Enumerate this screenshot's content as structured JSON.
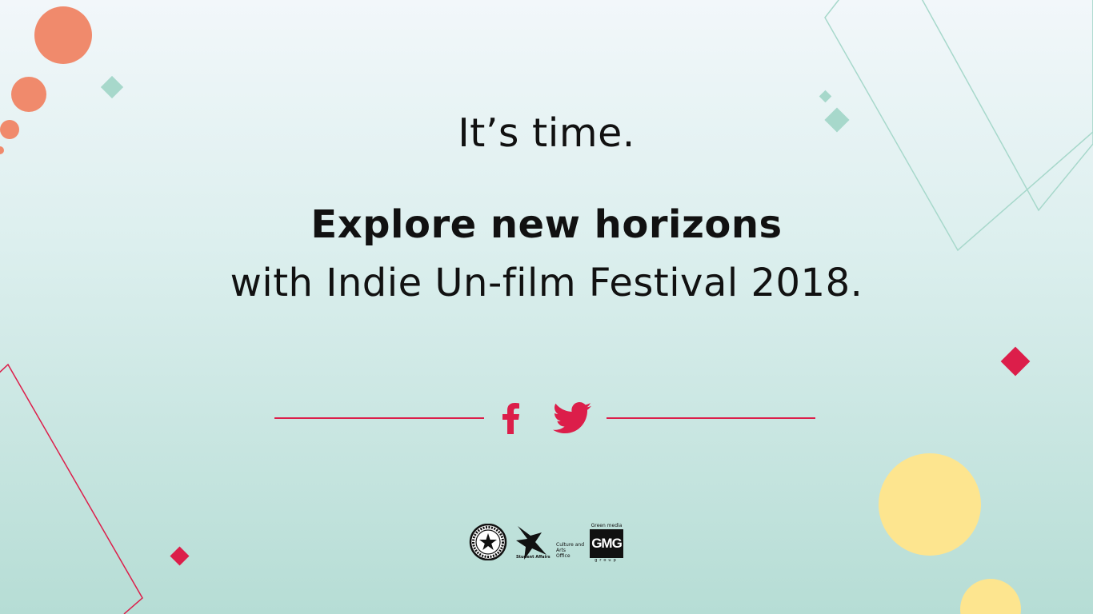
{
  "headline": {
    "tagline": "It’s time.",
    "title_bold": "Explore new horizons",
    "title_rest": "with Indie Un-film Festival 2018."
  },
  "social": {
    "facebook_icon": "facebook-icon",
    "twitter_icon": "twitter-icon",
    "accent_color": "#dc1e4a"
  },
  "logos": {
    "seal_icon": "university-seal-icon",
    "student_affairs_icon": "star-icon",
    "student_affairs_label": "Student Affairs",
    "culture_office_lines": [
      "Culture and",
      "Arts",
      "Office"
    ],
    "gmg_top": "Green media",
    "gmg_mark": "GMG",
    "gmg_bottom": "group"
  },
  "colors": {
    "coral": "#f08a6c",
    "mint": "#a7d8cb",
    "yellow": "#fde58f",
    "crimson": "#dc1e4a",
    "text": "#111111"
  }
}
